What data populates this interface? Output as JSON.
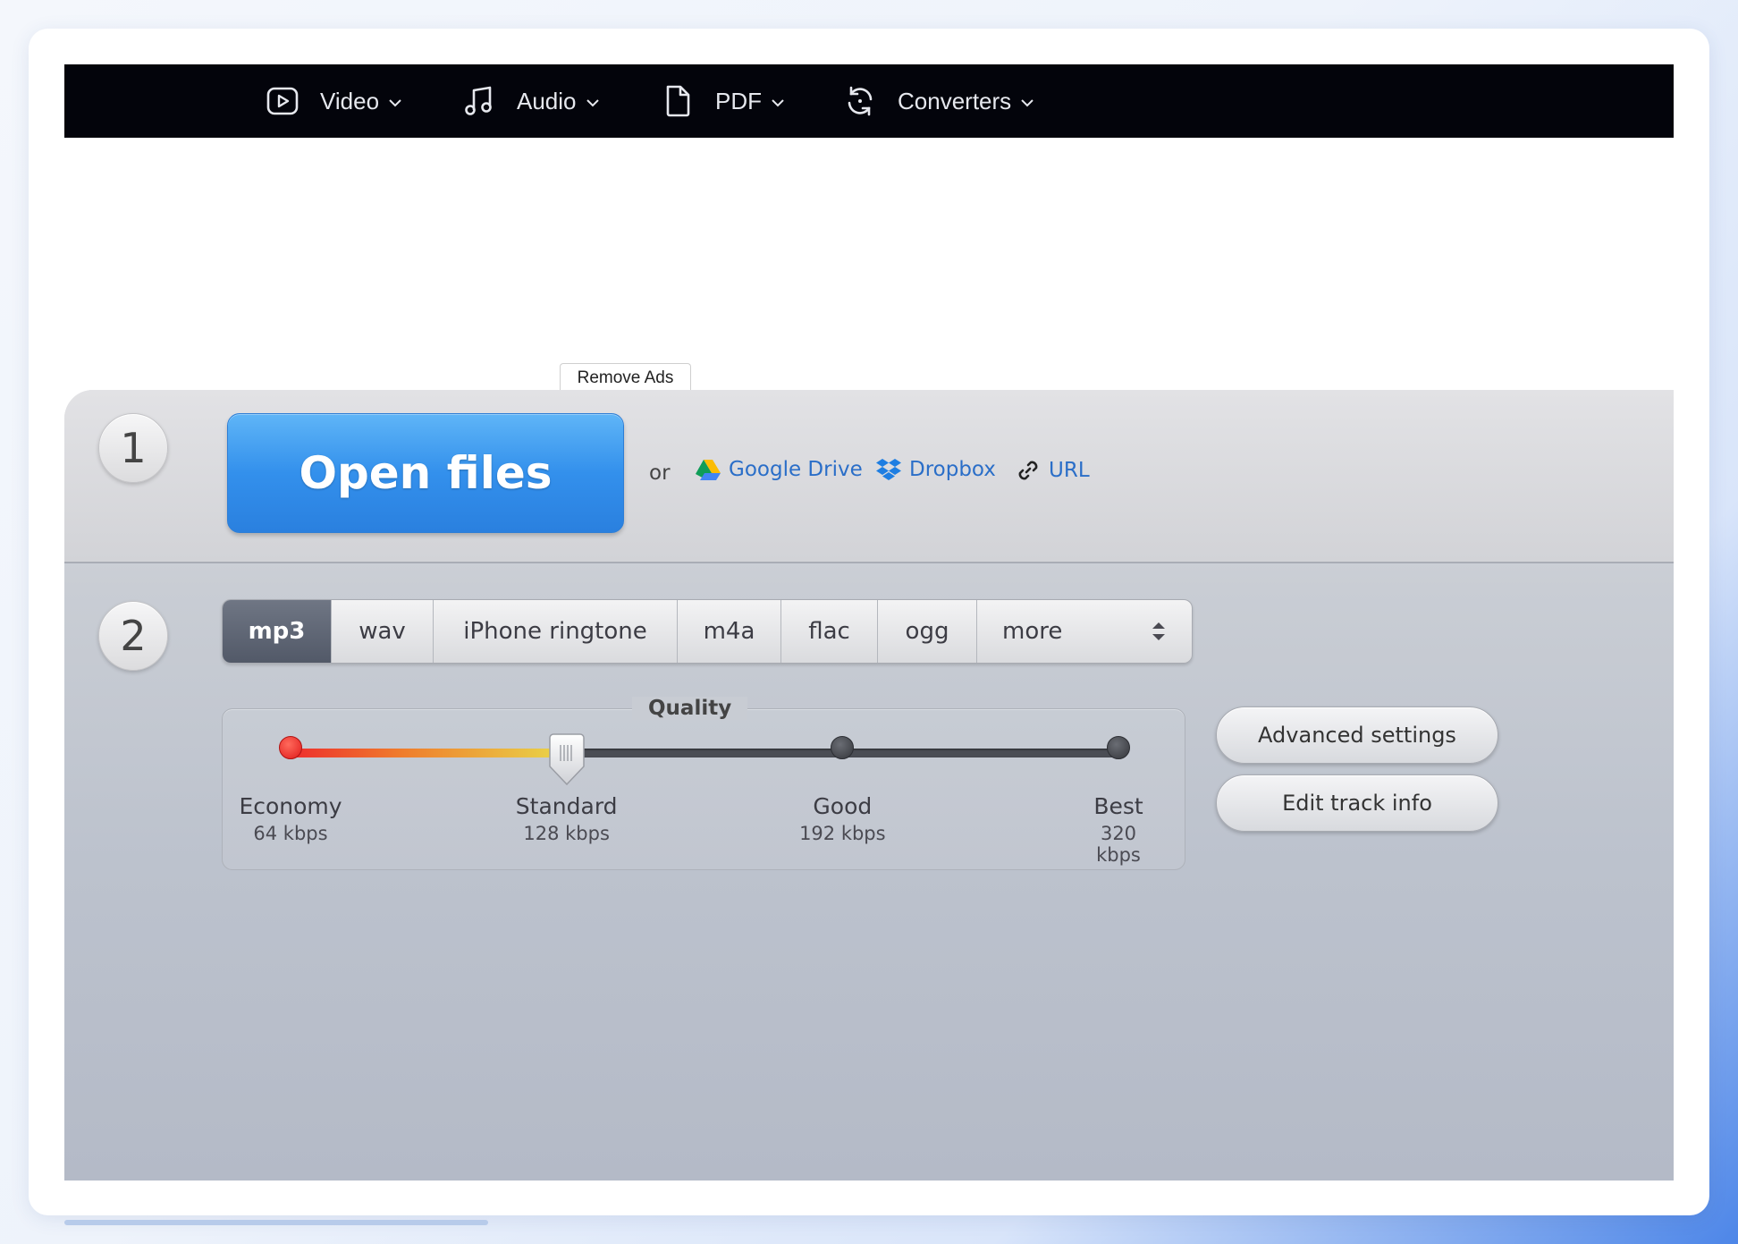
{
  "nav": {
    "items": [
      {
        "label": "Video",
        "icon": "video-play-icon"
      },
      {
        "label": "Audio",
        "icon": "music-note-icon"
      },
      {
        "label": "PDF",
        "icon": "document-icon"
      },
      {
        "label": "Converters",
        "icon": "refresh-icon"
      }
    ]
  },
  "ads": {
    "remove_label": "Remove Ads"
  },
  "step1": {
    "number": "1",
    "open_label": "Open files",
    "or_label": "or",
    "sources": [
      {
        "label": "Google Drive",
        "icon": "google-drive-icon"
      },
      {
        "label": "Dropbox",
        "icon": "dropbox-icon"
      },
      {
        "label": "URL",
        "icon": "link-icon"
      }
    ]
  },
  "step2": {
    "number": "2",
    "formats": [
      "mp3",
      "wav",
      "iPhone ringtone",
      "m4a",
      "flac",
      "ogg",
      "more"
    ],
    "selected_format": "mp3",
    "quality": {
      "title": "Quality",
      "levels": [
        {
          "name": "Economy",
          "kbps": "64 kbps"
        },
        {
          "name": "Standard",
          "kbps": "128 kbps"
        },
        {
          "name": "Good",
          "kbps": "192 kbps"
        },
        {
          "name": "Best",
          "kbps": "320 kbps"
        }
      ],
      "selected_index": 1
    },
    "advanced_label": "Advanced settings",
    "edit_track_label": "Edit track info"
  },
  "colors": {
    "accent": "#3390ec",
    "link": "#2a6ec8",
    "nav_bg": "#03040b",
    "active_format": "#5a6170"
  }
}
